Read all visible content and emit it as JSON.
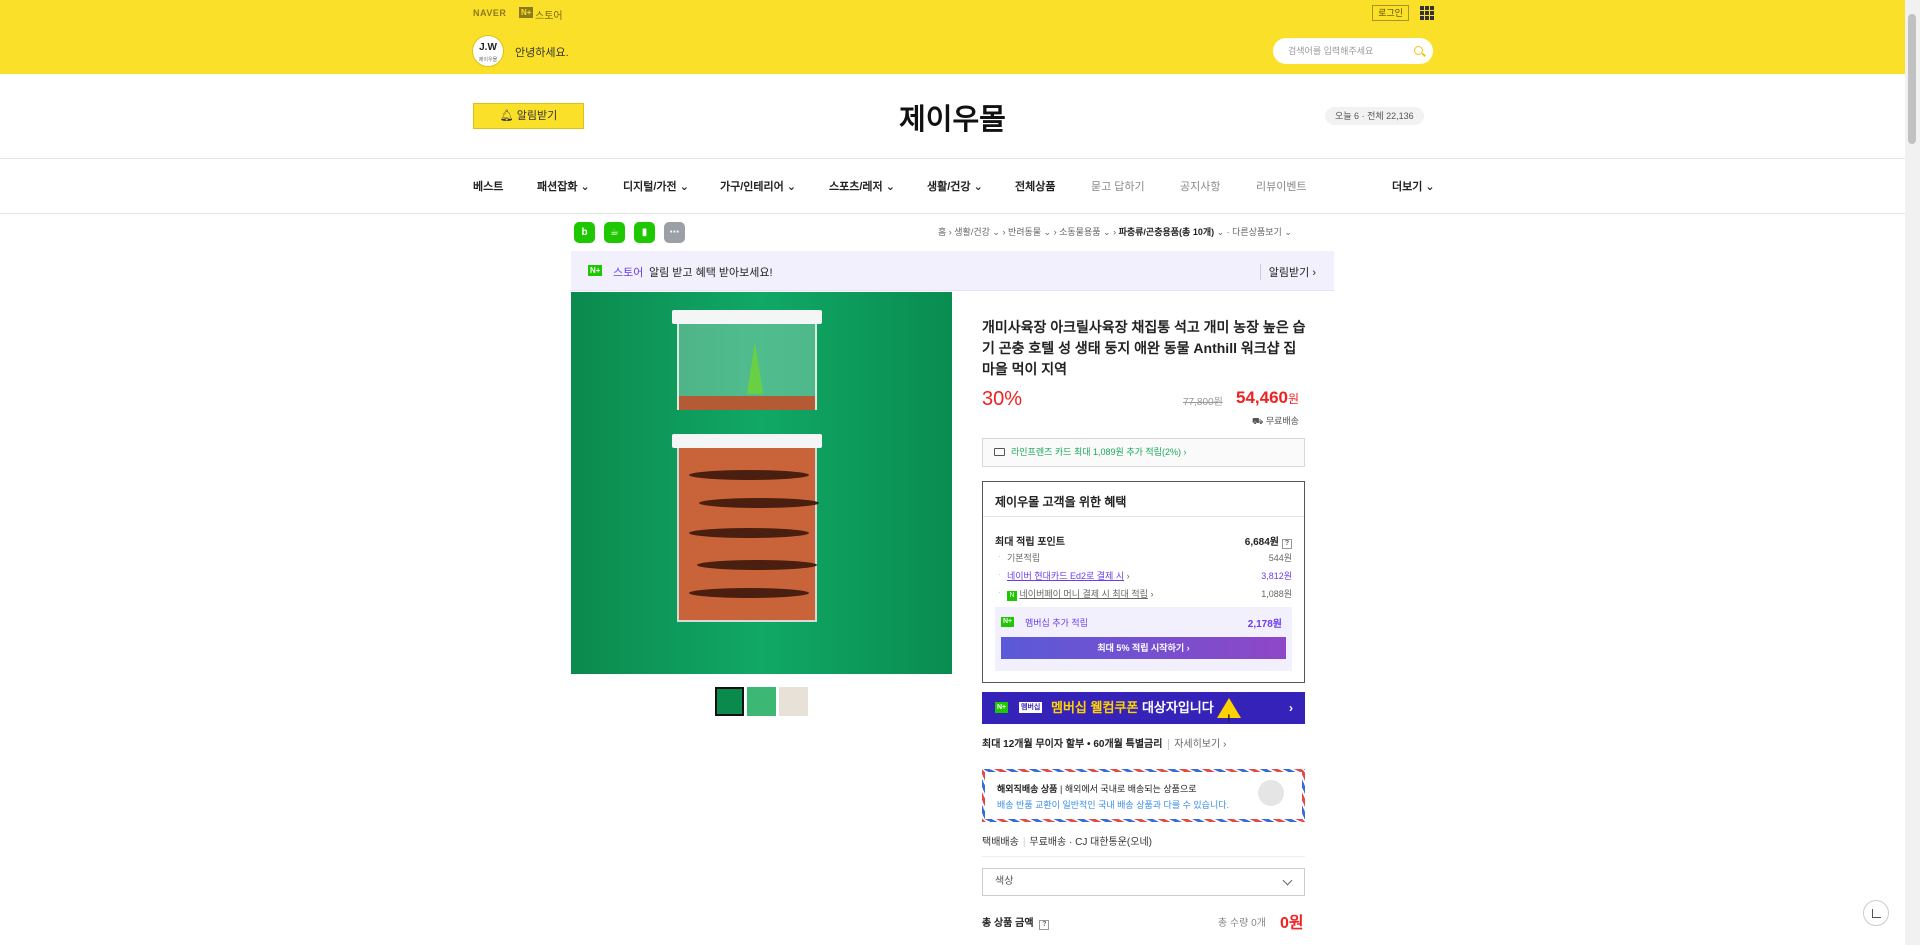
{
  "gnb": {
    "naver": "NAVER",
    "np_badge": "N+",
    "store": "스토어",
    "login": "로그인"
  },
  "store": {
    "avatar_main": "J.W",
    "avatar_sub": "제이우몰",
    "greeting": "안녕하세요.",
    "search_placeholder": "검색어를 입력해주세요",
    "alarm_button": "알림받기",
    "title": "제이우몰",
    "visitors": "오늘 6 · 전체 22,136"
  },
  "nav": {
    "items": [
      "베스트",
      "패션잡화",
      "디지털/가전",
      "가구/인테리어",
      "스포츠/레저",
      "생활/건강",
      "전체상품",
      "묻고 답하기",
      "공지사항",
      "리뷰이벤트"
    ],
    "more": "더보기"
  },
  "toolbar": {
    "icons": [
      "blog-icon",
      "cafe-icon",
      "bookmark-icon",
      "more-icon"
    ]
  },
  "breadcrumb": {
    "home": "홈",
    "items": [
      "생활/건강",
      "반려동물",
      "소동물용품"
    ],
    "current": "파충류/곤충용품(총 10개)",
    "other": "다른상품보기"
  },
  "promo": {
    "np": "N+",
    "store": "스토어",
    "message": "알림 받고 혜택 받아보세요!",
    "action": "알림받기 ›"
  },
  "product": {
    "title": "개미사육장 아크릴사육장 채집통 석고 개미 농장 높은 습기 곤충 호텔 성 생태 둥지 애완 동물 Anthill 워크샵 집 마을 먹이 지역",
    "discount": "30%",
    "original_price": "77,800원",
    "price": "54,460",
    "price_unit": "원",
    "shipping": "무료배송",
    "card_benefit": "라인프렌즈 카드 최대 1,089원 추가 적립(2%) ›"
  },
  "benefit": {
    "heading": "제이우몰 고객을 위한 혜택",
    "max_point_label": "최대 적립 포인트",
    "max_point_value": "6,684원",
    "basic_label": "기본적립",
    "basic_value": "544원",
    "hyundai_label": "네이버 현대카드 Ed2로 결제 시",
    "hyundai_value": "3,812원",
    "npay_label": "네이버페이 머니 결제 시 최대 적립",
    "npay_value": "1,088원",
    "member_np": "N+",
    "member_label": "멤버십 추가 적립",
    "member_value": "2,178원",
    "member_button": "최대 5% 적립 시작하기 ›"
  },
  "coupon": {
    "np": "N+",
    "tag": "멤버십",
    "prefix": "멤버십 웰컴쿠폰",
    "suffix": " 대상자입니다",
    "arrow": "›"
  },
  "installment": {
    "text": "최대 12개월 무이자 할부 • 60개월 특별금리",
    "more": "자세히보기 ›"
  },
  "overseas": {
    "label": "해외직배송 상품",
    "desc": "해외에서 국내로 배송되는 상품으로",
    "note": "배송 반품 교환이 일반적인 국내 배송 상품과 다를 수 있습니다."
  },
  "delivery": {
    "method": "택배배송",
    "fee": "무료배송",
    "carrier": "CJ 대한통운(오네)"
  },
  "option": {
    "placeholder": "색상"
  },
  "total": {
    "label": "총 상품 금액",
    "count": "총 수량 0개",
    "value": "0원"
  },
  "colors": {
    "brand": "#fbe02a",
    "price": "#e22222",
    "naver_green": "#1ec800",
    "purple": "#6c3df0"
  }
}
